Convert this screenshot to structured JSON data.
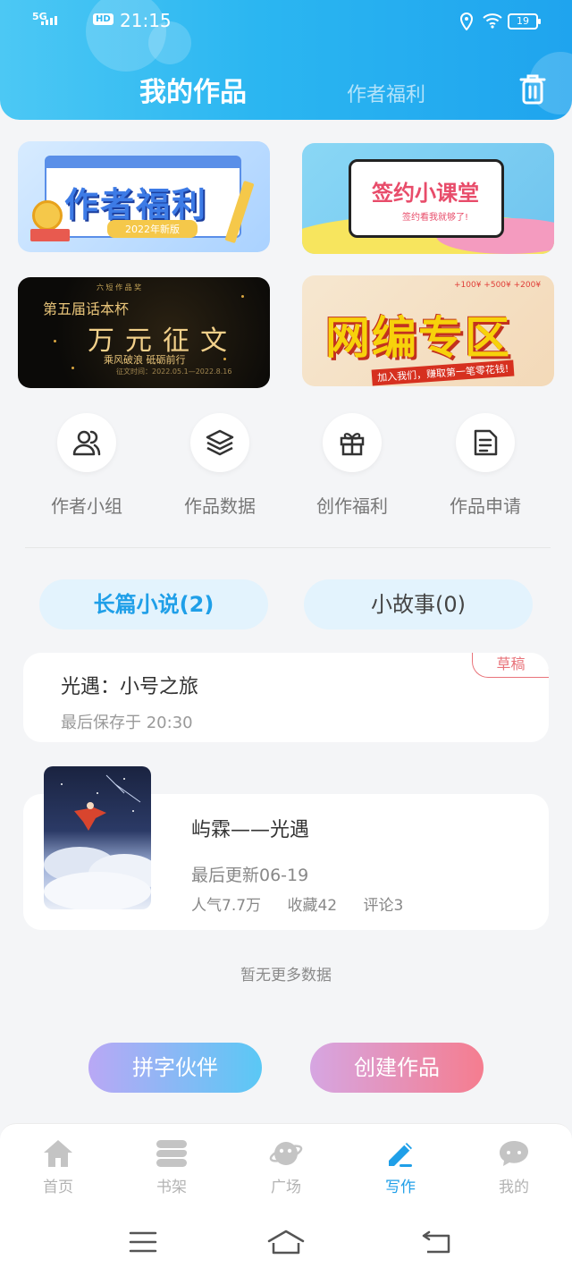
{
  "status_bar": {
    "signal": "5G",
    "hd": "HD",
    "time": "21:15",
    "battery": "19"
  },
  "header": {
    "tab_active": "我的作品",
    "tab_inactive": "作者福利",
    "trash_icon": "trash-icon"
  },
  "banners": [
    {
      "title": "作者福利",
      "subtitle": "2022年新版"
    },
    {
      "title": "签约小课堂",
      "subtitle": "签约看我就够了!"
    },
    {
      "top": "第五届话本杯",
      "title": "万元征文",
      "subtitle": "乘风破浪 砥砺前行",
      "top_small": "六 短 作 品 奖",
      "dates": "征文时间：2022.05.1—2022.8.16"
    },
    {
      "title": "网编专区",
      "subtitle": "加入我们，赚取第一笔零花钱!",
      "money": "+100¥  +500¥  +200¥"
    }
  ],
  "quick_actions": [
    {
      "label": "作者小组",
      "icon": "users-icon"
    },
    {
      "label": "作品数据",
      "icon": "layers-icon"
    },
    {
      "label": "创作福利",
      "icon": "gift-icon"
    },
    {
      "label": "作品申请",
      "icon": "document-icon"
    }
  ],
  "categories": {
    "long": "长篇小说(2)",
    "short": "小故事(0)"
  },
  "works": [
    {
      "title": "光遇：小号之旅",
      "subtitle": "最后保存于 20:30",
      "badge": "草稿"
    },
    {
      "title": "屿霖——光遇",
      "updated": "最后更新06-19",
      "popularity": "人气7.7万",
      "favorites": "收藏42",
      "comments": "评论3"
    }
  ],
  "no_more": "暂无更多数据",
  "buttons": {
    "partner": "拼字伙伴",
    "create": "创建作品"
  },
  "nav": [
    {
      "label": "首页",
      "icon": "home-icon"
    },
    {
      "label": "书架",
      "icon": "bookshelf-icon"
    },
    {
      "label": "广场",
      "icon": "planet-icon"
    },
    {
      "label": "写作",
      "icon": "pen-icon"
    },
    {
      "label": "我的",
      "icon": "chat-icon"
    }
  ],
  "colors": {
    "accent": "#1f9fe8",
    "header_start": "#4cc8f4",
    "header_end": "#1fa4ee",
    "draft": "#e8737a"
  }
}
